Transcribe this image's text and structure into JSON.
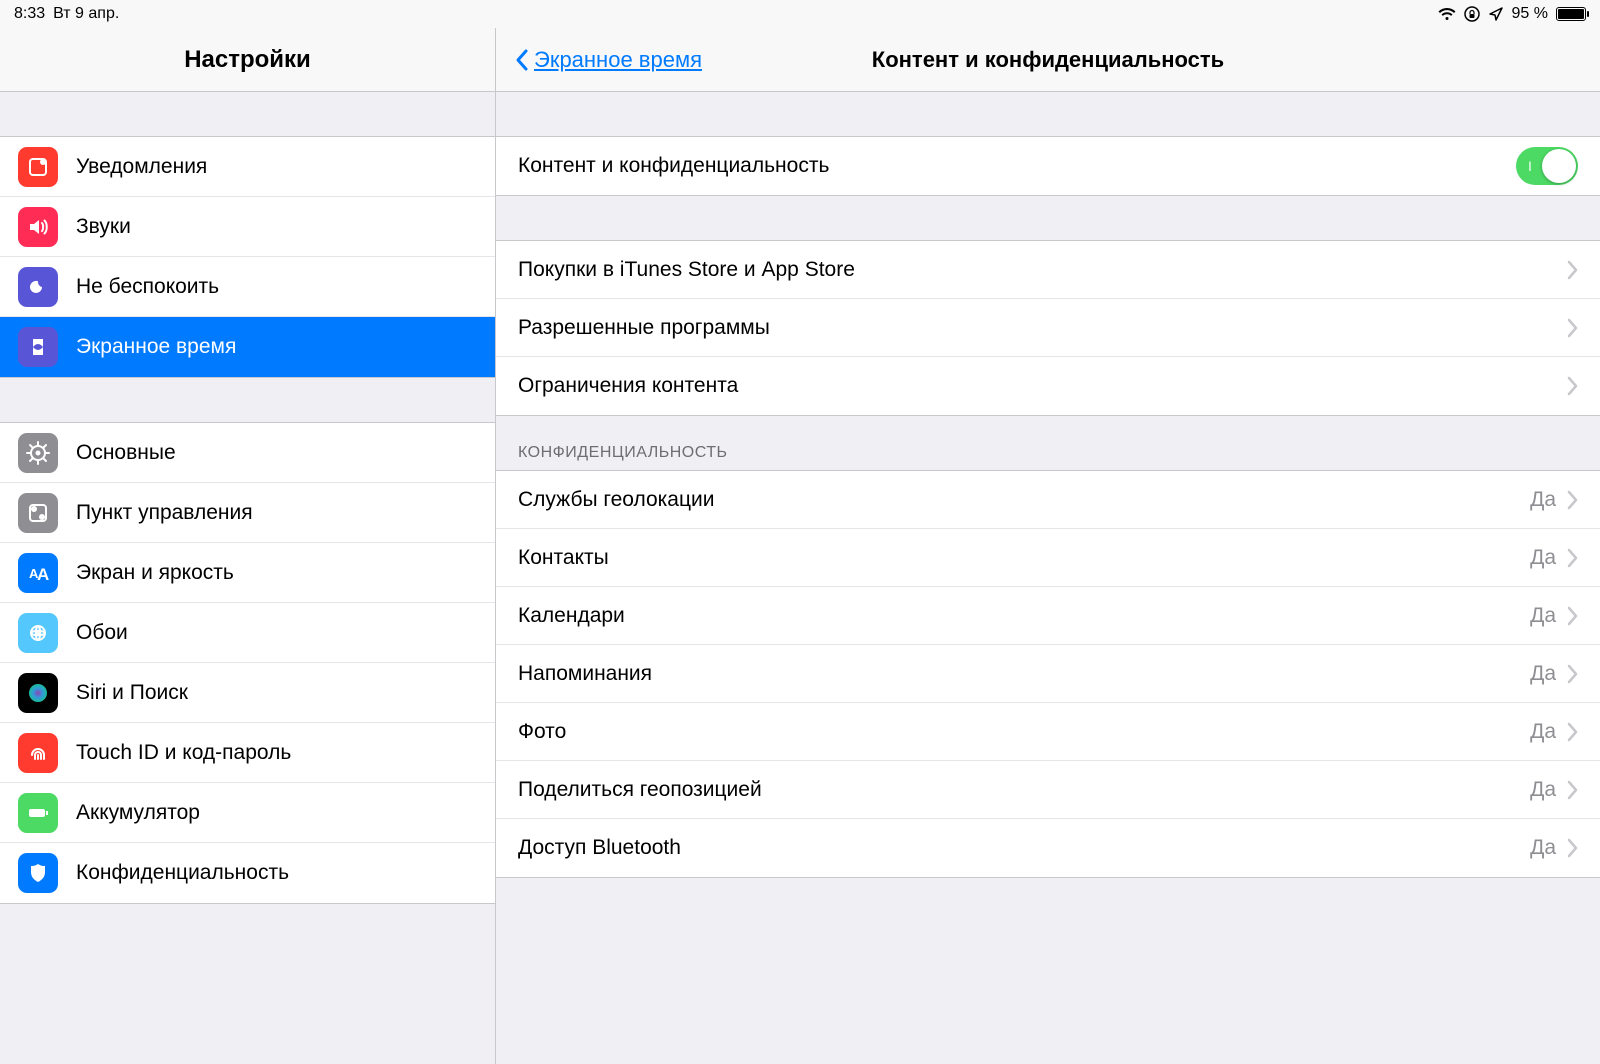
{
  "statusbar": {
    "time": "8:33",
    "date": "Вт 9 апр.",
    "battery_pct": "95 %"
  },
  "sidebar": {
    "title": "Настройки",
    "group1": [
      {
        "label": "Уведомления",
        "icon": "notifications",
        "bg": "#ff3b30"
      },
      {
        "label": "Звуки",
        "icon": "sounds",
        "bg": "#ff2d55"
      },
      {
        "label": "Не беспокоить",
        "icon": "dnd",
        "bg": "#5856d6"
      },
      {
        "label": "Экранное время",
        "icon": "screentime",
        "bg": "#5856d6",
        "selected": true
      }
    ],
    "group2": [
      {
        "label": "Основные",
        "icon": "general",
        "bg": "#8e8e93"
      },
      {
        "label": "Пункт управления",
        "icon": "control",
        "bg": "#8e8e93"
      },
      {
        "label": "Экран и яркость",
        "icon": "display",
        "bg": "#007aff"
      },
      {
        "label": "Обои",
        "icon": "wallpaper",
        "bg": "#54c7fc"
      },
      {
        "label": "Siri и Поиск",
        "icon": "siri",
        "bg": "#000"
      },
      {
        "label": "Touch ID и код-пароль",
        "icon": "touchid",
        "bg": "#ff3b30"
      },
      {
        "label": "Аккумулятор",
        "icon": "battery",
        "bg": "#4cd964"
      },
      {
        "label": "Конфиденциальность",
        "icon": "privacy",
        "bg": "#007aff"
      }
    ]
  },
  "detail": {
    "back_label": "Экранное время",
    "title": "Контент и конфиденциальность",
    "toggle_row": {
      "label": "Контент и конфиденциальность",
      "on": true
    },
    "group_general": [
      {
        "label": "Покупки в iTunes Store и App Store"
      },
      {
        "label": "Разрешенные программы"
      },
      {
        "label": "Ограничения контента"
      }
    ],
    "privacy_header": "КОНФИДЕНЦИАЛЬНОСТЬ",
    "value_yes": "Да",
    "group_privacy": [
      {
        "label": "Службы геолокации",
        "value": "Да"
      },
      {
        "label": "Контакты",
        "value": "Да"
      },
      {
        "label": "Календари",
        "value": "Да"
      },
      {
        "label": "Напоминания",
        "value": "Да"
      },
      {
        "label": "Фото",
        "value": "Да"
      },
      {
        "label": "Поделиться геопозицией",
        "value": "Да"
      },
      {
        "label": "Доступ Bluetooth",
        "value": "Да"
      }
    ]
  }
}
